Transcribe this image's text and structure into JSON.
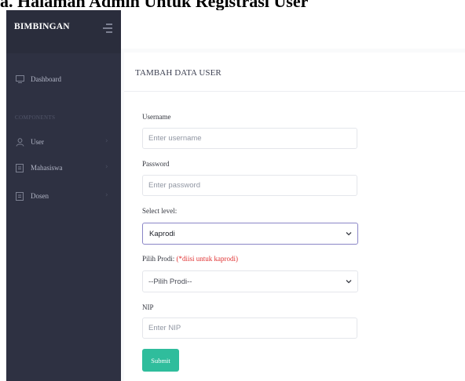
{
  "document": {
    "caption": "a.   Halaman Admin Untuk Registrasi User"
  },
  "sidebar": {
    "brand": "BIMBINGAN",
    "dashboard_label": "Dashboard",
    "section_label": "COMPONENTS",
    "items": [
      {
        "label": "User",
        "icon": "user-icon"
      },
      {
        "label": "Mahasiswa",
        "icon": "document-icon"
      },
      {
        "label": "Dosen",
        "icon": "document-icon"
      }
    ]
  },
  "form": {
    "title": "TAMBAH DATA USER",
    "username": {
      "label": "Username",
      "placeholder": "Enter username"
    },
    "password": {
      "label": "Password",
      "placeholder": "Enter password"
    },
    "level": {
      "label": "Select level:",
      "selected": "Kaprodi"
    },
    "prodi": {
      "label": "Pilih Prodi:",
      "note": "(*diisi untuk kaprodi)",
      "selected": "--Pilih Prodi--"
    },
    "nip": {
      "label": "NIP",
      "placeholder": "Enter NIP"
    },
    "submit_label": "Submit"
  },
  "colors": {
    "sidebar_bg": "#2e3142",
    "accent": "#2fbd9c",
    "required_note": "#e03131",
    "active_border": "#8a86c7"
  }
}
